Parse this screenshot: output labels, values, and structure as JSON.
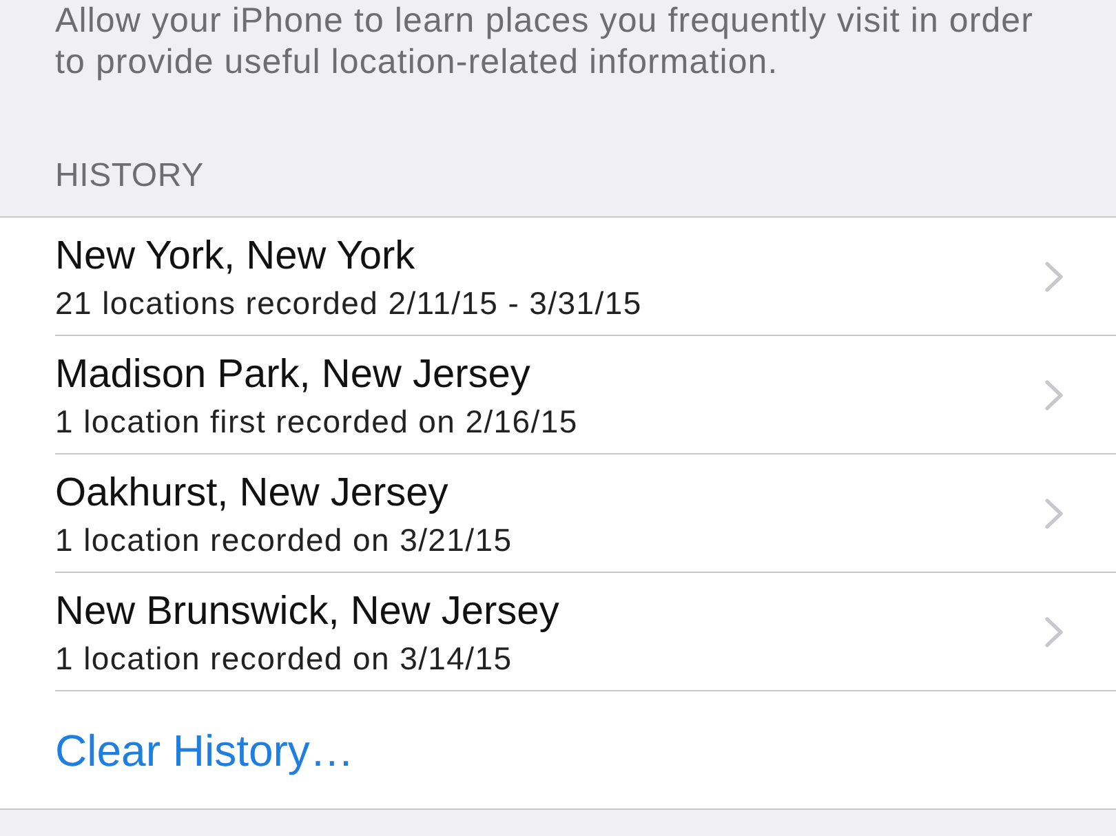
{
  "description": "Allow your iPhone to learn places you frequently visit in order to provide useful location-related information.",
  "section_header": "HISTORY",
  "history": [
    {
      "place": "New York, New York",
      "detail": "21 locations recorded 2/11/15 - 3/31/15"
    },
    {
      "place": "Madison Park, New Jersey",
      "detail": "1 location first recorded on 2/16/15"
    },
    {
      "place": "Oakhurst, New Jersey",
      "detail": "1 location recorded on 3/21/15"
    },
    {
      "place": "New Brunswick, New Jersey",
      "detail": "1 location recorded on 3/14/15"
    }
  ],
  "clear_button": "Clear History…"
}
